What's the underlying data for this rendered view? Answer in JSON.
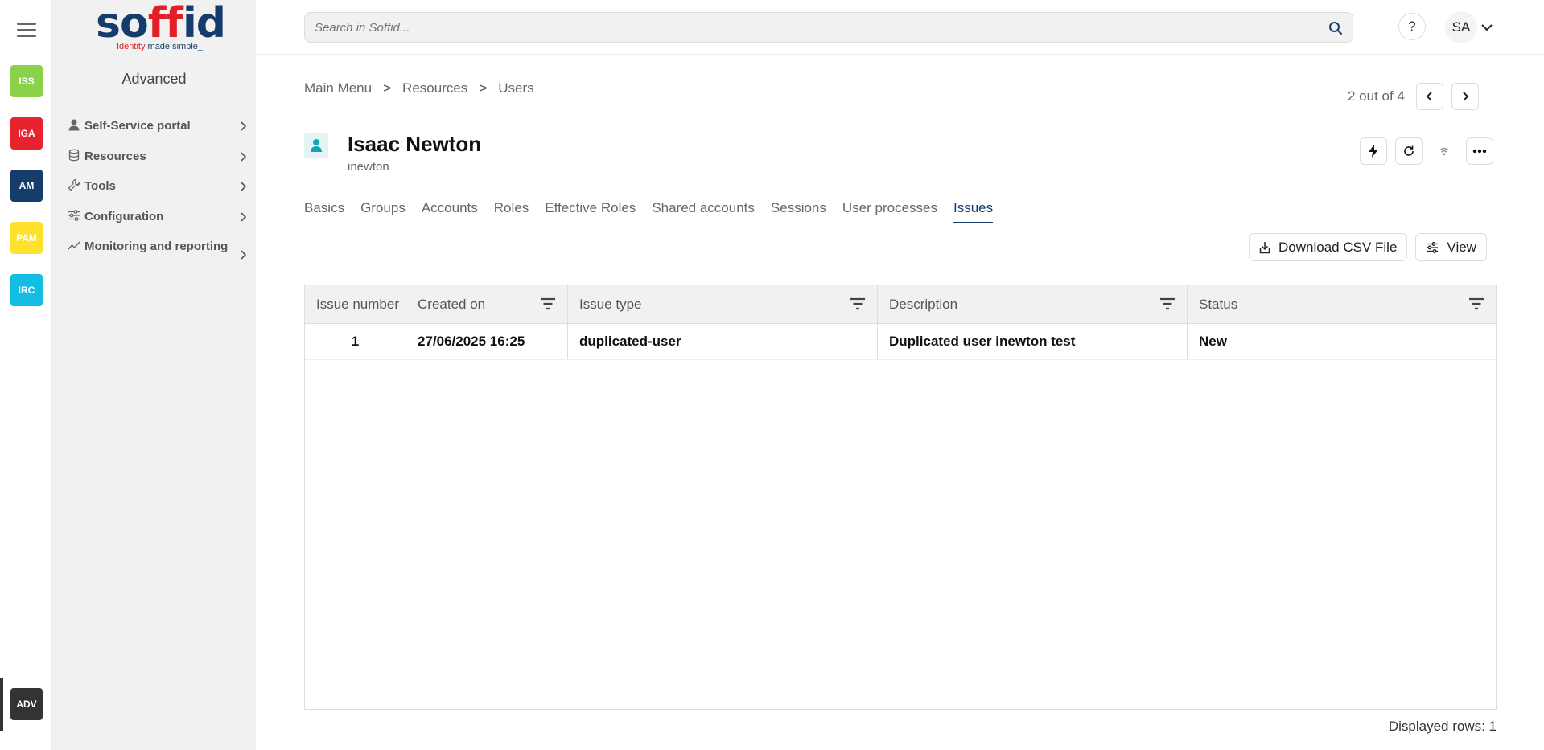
{
  "rail": {
    "apps": [
      {
        "label": "ISS",
        "color": "#8cd14a"
      },
      {
        "label": "IGA",
        "color": "#e8232f"
      },
      {
        "label": "AM",
        "color": "#153d6b"
      },
      {
        "label": "PAM",
        "color": "#fde12d"
      },
      {
        "label": "IRC",
        "color": "#14bde4"
      }
    ],
    "adv": {
      "label": "ADV",
      "color": "#333333"
    }
  },
  "sidebar": {
    "logo": {
      "main": "soffid",
      "tag_highlight": "Identity",
      "tag_rest": " made simple_"
    },
    "section_title": "Advanced",
    "items": [
      {
        "label": "Self-Service portal",
        "icon": "person-icon"
      },
      {
        "label": "Resources",
        "icon": "database-icon"
      },
      {
        "label": "Tools",
        "icon": "wrench-icon"
      },
      {
        "label": "Configuration",
        "icon": "sliders-icon"
      },
      {
        "label": "Monitoring and reporting",
        "icon": "trend-icon"
      }
    ]
  },
  "topbar": {
    "search_placeholder": "Search in Soffid...",
    "help_label": "?",
    "user_initials": "SA"
  },
  "breadcrumb": {
    "items": [
      "Main Menu",
      "Resources",
      "Users"
    ],
    "separator": ">"
  },
  "pager": {
    "text": "2 out of 4"
  },
  "user": {
    "name": "Isaac Newton",
    "login": "inewton"
  },
  "tabs": [
    "Basics",
    "Groups",
    "Accounts",
    "Roles",
    "Effective Roles",
    "Shared accounts",
    "Sessions",
    "User processes",
    "Issues"
  ],
  "active_tab": "Issues",
  "toolbar": {
    "download_label": "Download CSV File",
    "view_label": "View"
  },
  "table": {
    "columns": [
      "Issue number",
      "Created on",
      "Issue type",
      "Description",
      "Status"
    ],
    "rows": [
      {
        "number": "1",
        "created": "27/06/2025 16:25",
        "type": "duplicated-user",
        "description": "Duplicated user inewton test",
        "status": "New"
      }
    ]
  },
  "footer": {
    "displayed_rows": "Displayed rows: 1"
  },
  "colors": {
    "brand": "#153d6b",
    "accent": "#e41e26"
  }
}
